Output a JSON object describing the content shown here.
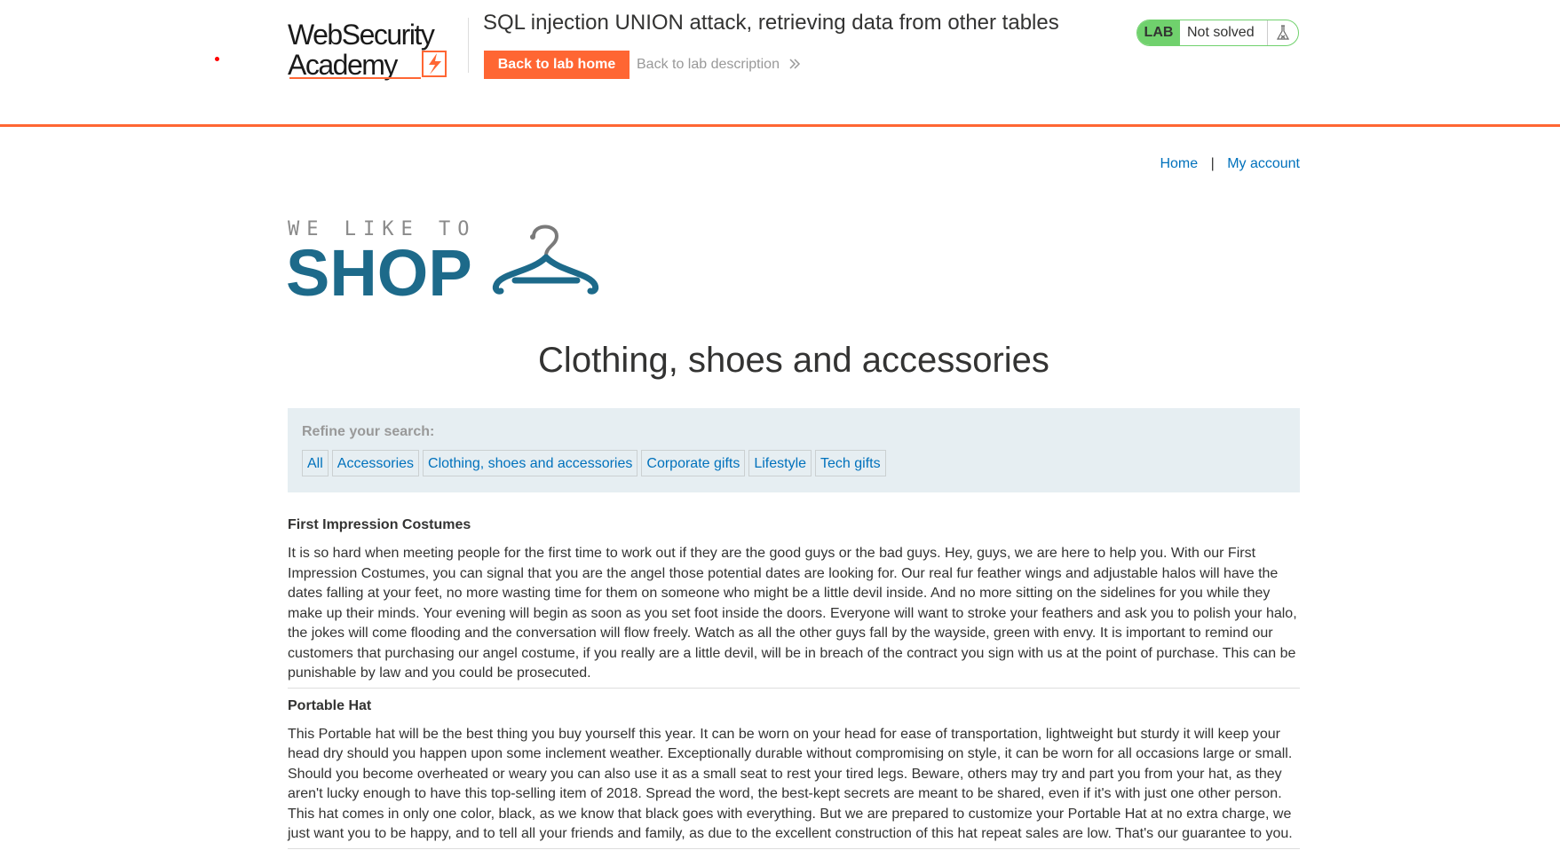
{
  "lab_header": {
    "title": "SQL injection UNION attack, retrieving data from other tables",
    "back_home_label": "Back to lab home",
    "back_description_label": "Back to lab description",
    "status_badge": "LAB",
    "status_text": "Not solved",
    "logo_line1": "WebSecurity",
    "logo_line2": "Academy",
    "accent_color": "#ff6633",
    "status_color": "#70d16d",
    "flask_icon": "flask-icon"
  },
  "account_nav": {
    "home": "Home",
    "separator": "|",
    "my_account": "My account"
  },
  "shop_logo": {
    "tagline": "WE LIKE TO",
    "name": "SHOP",
    "icon": "hanger-icon",
    "color": "#1d6a8a"
  },
  "page": {
    "heading": "Clothing, shoes and accessories"
  },
  "filter": {
    "label": "Refine your search:",
    "categories": [
      "All",
      "Accessories",
      "Clothing, shoes and accessories",
      "Corporate gifts",
      "Lifestyle",
      "Tech gifts"
    ]
  },
  "products": [
    {
      "title": "First Impression Costumes",
      "description": "It is so hard when meeting people for the first time to work out if they are the good guys or the bad guys. Hey, guys, we are here to help you. With our First Impression Costumes, you can signal that you are the angel those potential dates are looking for. Our real fur feather wings and adjustable halos will have the dates falling at your feet, no more wasting time for them on someone who might be a little devil inside. And no more sitting on the sidelines for you while they make up their minds. Your evening will begin as soon as you set foot inside the doors. Everyone will want to stroke your feathers and ask you to polish your halo, the jokes will come flooding and the conversation will flow freely. Watch as all the other guys fall by the wayside, green with envy. It is important to remind our customers that purchasing our angel costume, if you really are a little devil, will be in breach of the contract you sign with us at the point of purchase. This can be punishable by law and you could be prosecuted."
    },
    {
      "title": "Portable Hat",
      "description": "This Portable hat will be the best thing you buy yourself this year. It can be worn on your head for ease of transportation, lightweight but sturdy it will keep your head dry should you happen upon some inclement weather. Exceptionally durable without compromising on style, it can be worn for all occasions large or small. Should you become overheated or weary you can also use it as a small seat to rest your tired legs. Beware, others may try and part you from your hat, as they aren't lucky enough to have this top-selling item of 2018. Spread the word, the best-kept secrets are meant to be shared, even if it's with just one other person. This hat comes in only one color, black, as we know that black goes with everything. But we are prepared to customize your Portable Hat at no extra charge, we just want you to be happy, and to tell all your friends and family, as due to the excellent construction of this hat repeat sales are low. That's our guarantee to you."
    }
  ]
}
